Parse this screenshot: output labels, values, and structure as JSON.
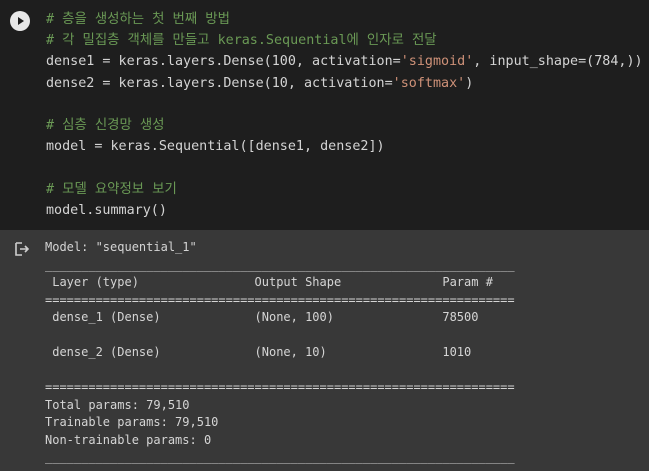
{
  "code_lines": [
    [
      {
        "t": "# 층을 생성하는 첫 번째 방법",
        "c": "cm"
      }
    ],
    [
      {
        "t": "# 각 밀집층 객체를 만들고 keras.Sequential에 인자로 전달",
        "c": "cm"
      }
    ],
    [
      {
        "t": "dense1 = keras.layers.Dense(100, activation=",
        "c": ""
      },
      {
        "t": "'sigmoid'",
        "c": "str"
      },
      {
        "t": ", input_shape=(784,))",
        "c": ""
      }
    ],
    [
      {
        "t": "dense2 = keras.layers.Dense(10, activation=",
        "c": ""
      },
      {
        "t": "'softmax'",
        "c": "str"
      },
      {
        "t": ")",
        "c": ""
      }
    ],
    [
      {
        "t": "",
        "c": ""
      }
    ],
    [
      {
        "t": "# 심층 신경망 생성",
        "c": "cm"
      }
    ],
    [
      {
        "t": "model = keras.Sequential([dense1, dense2])",
        "c": ""
      }
    ],
    [
      {
        "t": "",
        "c": ""
      }
    ],
    [
      {
        "t": "# 모델 요약정보 보기",
        "c": "cm"
      }
    ],
    [
      {
        "t": "model.summary()",
        "c": ""
      }
    ]
  ],
  "output": {
    "model_line": "Model: \"sequential_1\"",
    "rule_thin": "_________________________________________________________________",
    "header": " Layer (type)                Output Shape              Param #   ",
    "rule_thick": "=================================================================",
    "rows": [
      " dense_1 (Dense)             (None, 100)               78500     ",
      "",
      " dense_2 (Dense)             (None, 10)                1010      ",
      ""
    ],
    "total": "Total params: 79,510",
    "trainable": "Trainable params: 79,510",
    "non_trainable": "Non-trainable params: 0"
  },
  "icons": {
    "run": "run-cell-icon",
    "output": "output-redirect-icon"
  }
}
